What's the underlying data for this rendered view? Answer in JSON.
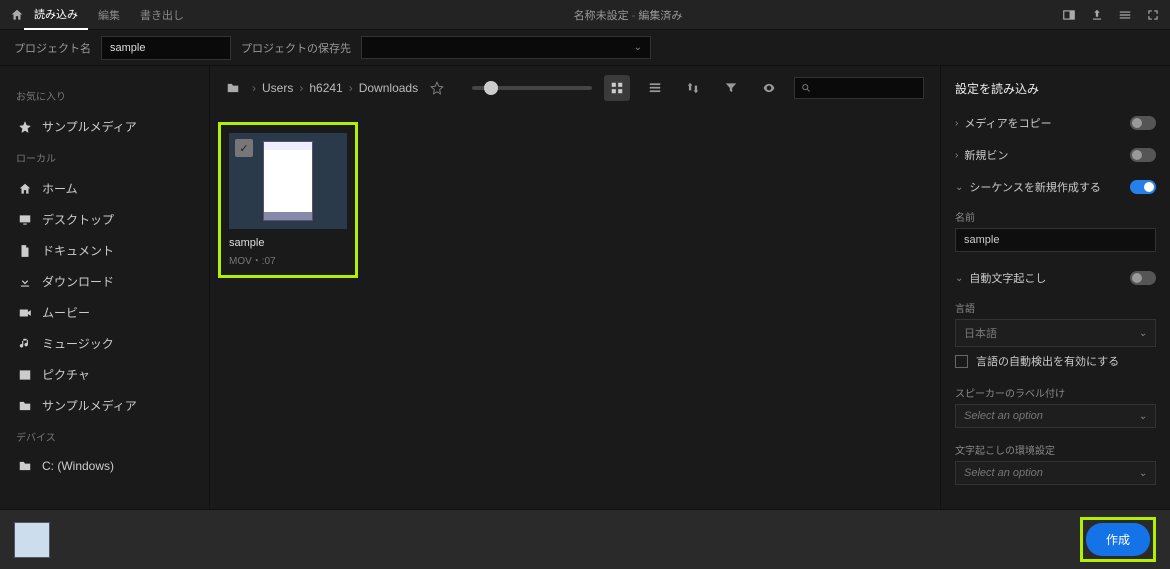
{
  "window": {
    "title": "名称未設定",
    "status": "編集済み"
  },
  "tabs": {
    "import": "読み込み",
    "edit": "編集",
    "export": "書き出し"
  },
  "project": {
    "name_label": "プロジェクト名",
    "name_value": "sample",
    "save_label": "プロジェクトの保存先",
    "save_value": ""
  },
  "sidebar": {
    "favorites_title": "お気に入り",
    "favorites": [
      {
        "label": "サンプルメディア",
        "icon": "star"
      }
    ],
    "local_title": "ローカル",
    "local": [
      {
        "label": "ホーム",
        "icon": "home"
      },
      {
        "label": "デスクトップ",
        "icon": "desktop"
      },
      {
        "label": "ドキュメント",
        "icon": "document"
      },
      {
        "label": "ダウンロード",
        "icon": "download"
      },
      {
        "label": "ムービー",
        "icon": "video"
      },
      {
        "label": "ミュージック",
        "icon": "music"
      },
      {
        "label": "ピクチャ",
        "icon": "picture"
      },
      {
        "label": "サンプルメディア",
        "icon": "folder"
      }
    ],
    "devices_title": "デバイス",
    "devices": [
      {
        "label": "C: (Windows)",
        "icon": "folder"
      }
    ]
  },
  "breadcrumb": [
    "Users",
    "h6241",
    "Downloads"
  ],
  "search_placeholder": "",
  "files": [
    {
      "name": "sample",
      "meta": "MOV・:07",
      "selected": true
    }
  ],
  "settings": {
    "heading": "設定を読み込み",
    "copy_media": "メディアをコピー",
    "new_bin": "新規ビン",
    "create_sequence": "シーケンスを新規作成する",
    "name_label": "名前",
    "name_value": "sample",
    "auto_transcribe": "自動文字起こし",
    "language_label": "言語",
    "language_value": "日本語",
    "auto_detect": "言語の自動検出を有効にする",
    "speaker_label": "スピーカーのラベル付け",
    "select_placeholder": "Select an option",
    "env_label": "文字起こしの環境設定"
  },
  "create_button": "作成"
}
